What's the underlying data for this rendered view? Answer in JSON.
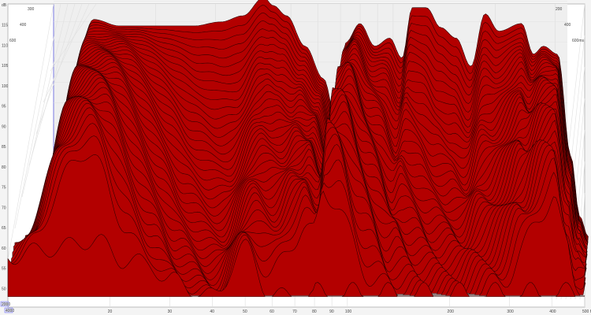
{
  "chart_data": {
    "type": "waterfall",
    "title": "",
    "xlabel": "Hz",
    "ylabel": "dB",
    "xscale": "log",
    "xlim": [
      10,
      500
    ],
    "ylim": [
      45,
      120
    ],
    "x_ticks": [
      "20",
      "30",
      "40",
      "50",
      "60",
      "70",
      "80",
      "90",
      "100",
      "200",
      "300",
      "400",
      "500 Hz"
    ],
    "x_tick_values": [
      20,
      30,
      40,
      50,
      60,
      70,
      80,
      90,
      100,
      200,
      300,
      400,
      500
    ],
    "y_ticks": [
      "dB",
      "115",
      "110",
      "105",
      "100",
      "95",
      "90",
      "85",
      "80",
      "75",
      "70",
      "65",
      "60",
      "55",
      "50"
    ],
    "y_tick_values": [
      120,
      115,
      110,
      105,
      100,
      95,
      90,
      85,
      80,
      75,
      70,
      65,
      60,
      55,
      50
    ],
    "time_ticks_left": [
      "300",
      "400",
      "600"
    ],
    "time_ticks_right": [
      "200",
      "400",
      "600ms"
    ],
    "corner_labels": [
      "2000",
      "4000"
    ],
    "floor_db": 48,
    "slices": 40,
    "first_slice_profile": {
      "freq_hz": [
        10,
        13.4,
        16.2,
        22,
        27.9,
        34,
        40,
        46.5,
        50,
        55,
        63,
        72,
        80,
        85,
        94,
        105,
        117,
        128,
        138,
        153,
        170,
        190,
        212,
        235,
        260,
        307,
        335,
        360,
        400,
        440,
        470,
        500
      ],
      "level_db": [
        60,
        108.6,
        107,
        107,
        107,
        108,
        109.5,
        114,
        112,
        109.5,
        102,
        94,
        82,
        103,
        107.6,
        102,
        104,
        99,
        111.5,
        111.5,
        106.6,
        104,
        97,
        110,
        105.7,
        107.6,
        100,
        102,
        100,
        75,
        60,
        55
      ]
    },
    "last_slice_profile": {
      "freq_hz": [
        10,
        14,
        18,
        22,
        26,
        30,
        40,
        50,
        60,
        80,
        100,
        200,
        300,
        500
      ],
      "level_db": [
        58,
        60,
        62,
        57,
        56,
        52,
        48,
        60,
        48,
        48,
        48,
        48,
        48,
        48
      ]
    },
    "fill_color": "#b30000",
    "line_color": "#2a0000"
  }
}
